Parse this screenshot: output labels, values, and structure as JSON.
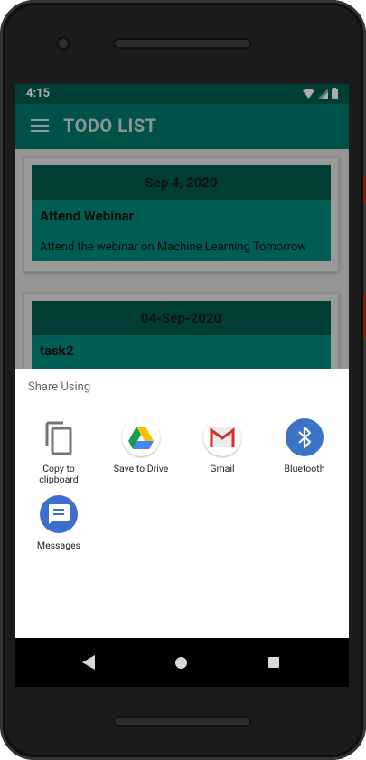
{
  "status_bar": {
    "time": "4:15",
    "icons": [
      "wifi-icon",
      "signal-icon",
      "battery-icon"
    ]
  },
  "app_bar": {
    "menu_icon": "hamburger-menu-icon",
    "title": "TODO LIST"
  },
  "todos": [
    {
      "date": "Sep 4, 2020",
      "title": "Attend Webinar",
      "description": "Attend the webinar on Machine Learning Tomorrow"
    },
    {
      "date": "04-Sep-2020",
      "title": "task2",
      "description": ""
    }
  ],
  "share_sheet": {
    "title": "Share Using",
    "items": [
      {
        "label_line1": "Copy to",
        "label_line2": "clipboard",
        "icon": "copy-icon"
      },
      {
        "label_line1": "Save to Drive",
        "label_line2": "",
        "icon": "google-drive-icon"
      },
      {
        "label_line1": "Gmail",
        "label_line2": "",
        "icon": "gmail-icon"
      },
      {
        "label_line1": "Bluetooth",
        "label_line2": "",
        "icon": "bluetooth-icon"
      },
      {
        "label_line1": "Messages",
        "label_line2": "",
        "icon": "messages-icon"
      }
    ]
  },
  "nav_bar": {
    "icons": [
      "back-icon",
      "home-icon",
      "recents-icon"
    ]
  },
  "colors": {
    "status_bar": "#005b4f",
    "app_bar": "#00796b",
    "card_header": "#005b4f",
    "card_body": "#00897b",
    "bluetooth": "#3b73c6",
    "messages": "#3f6fcc"
  }
}
